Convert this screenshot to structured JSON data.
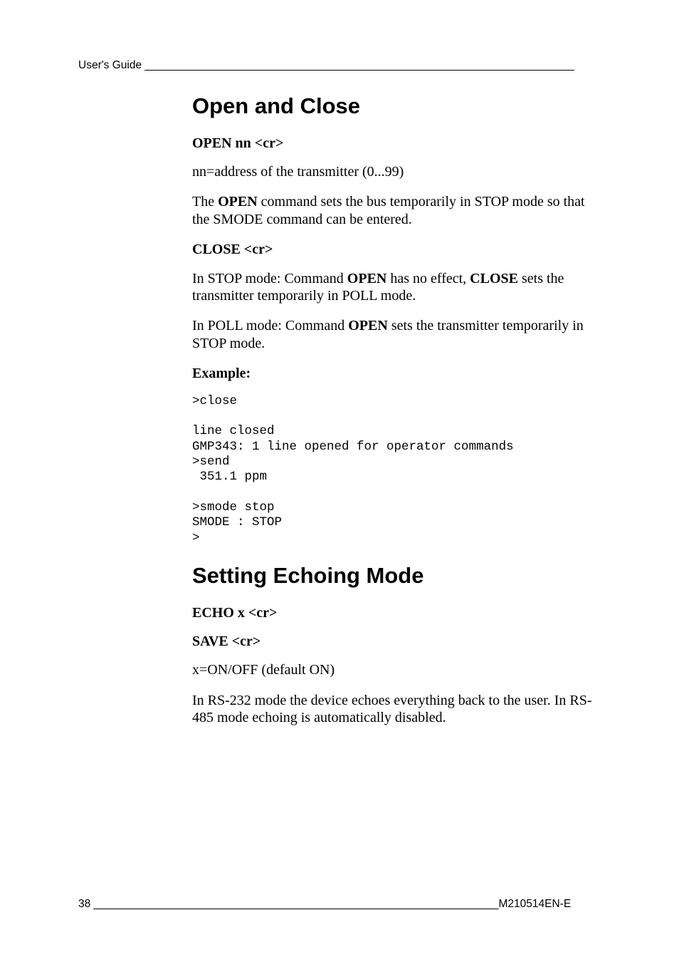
{
  "header": {
    "running_head": "User's Guide ______________________________________________________________________"
  },
  "section1": {
    "title": "Open and Close",
    "cmd_open": "OPEN nn <cr>",
    "p_addr": "nn=address of the transmitter (0...99)",
    "p_open_desc_pre": "The ",
    "p_open_desc_bold": "OPEN",
    "p_open_desc_post": " command sets the bus temporarily in STOP mode so that the SMODE command can be entered.",
    "cmd_close": "CLOSE <cr>",
    "p_stop_pre": "In STOP mode: Command ",
    "p_stop_b1": "OPEN",
    "p_stop_mid": " has no effect, ",
    "p_stop_b2": "CLOSE",
    "p_stop_post": " sets the transmitter temporarily in POLL mode.",
    "p_poll_pre": "In POLL mode: Command ",
    "p_poll_b1": "OPEN",
    "p_poll_post": " sets the transmitter temporarily in STOP mode.",
    "example_label": "Example:",
    "example_text": ">close\n\nline closed\nGMP343: 1 line opened for operator commands\n>send\n 351.1 ppm\n\n>smode stop\nSMODE : STOP\n>"
  },
  "section2": {
    "title": "Setting Echoing Mode",
    "cmd_echo": "ECHO x <cr>",
    "cmd_save": "SAVE <cr>",
    "p_default": "x=ON/OFF (default ON)",
    "p_desc": "In RS-232 mode the device echoes everything back to the user. In RS-485 mode echoing is automatically disabled."
  },
  "footer": {
    "line": "38 __________________________________________________________________M210514EN-E"
  }
}
